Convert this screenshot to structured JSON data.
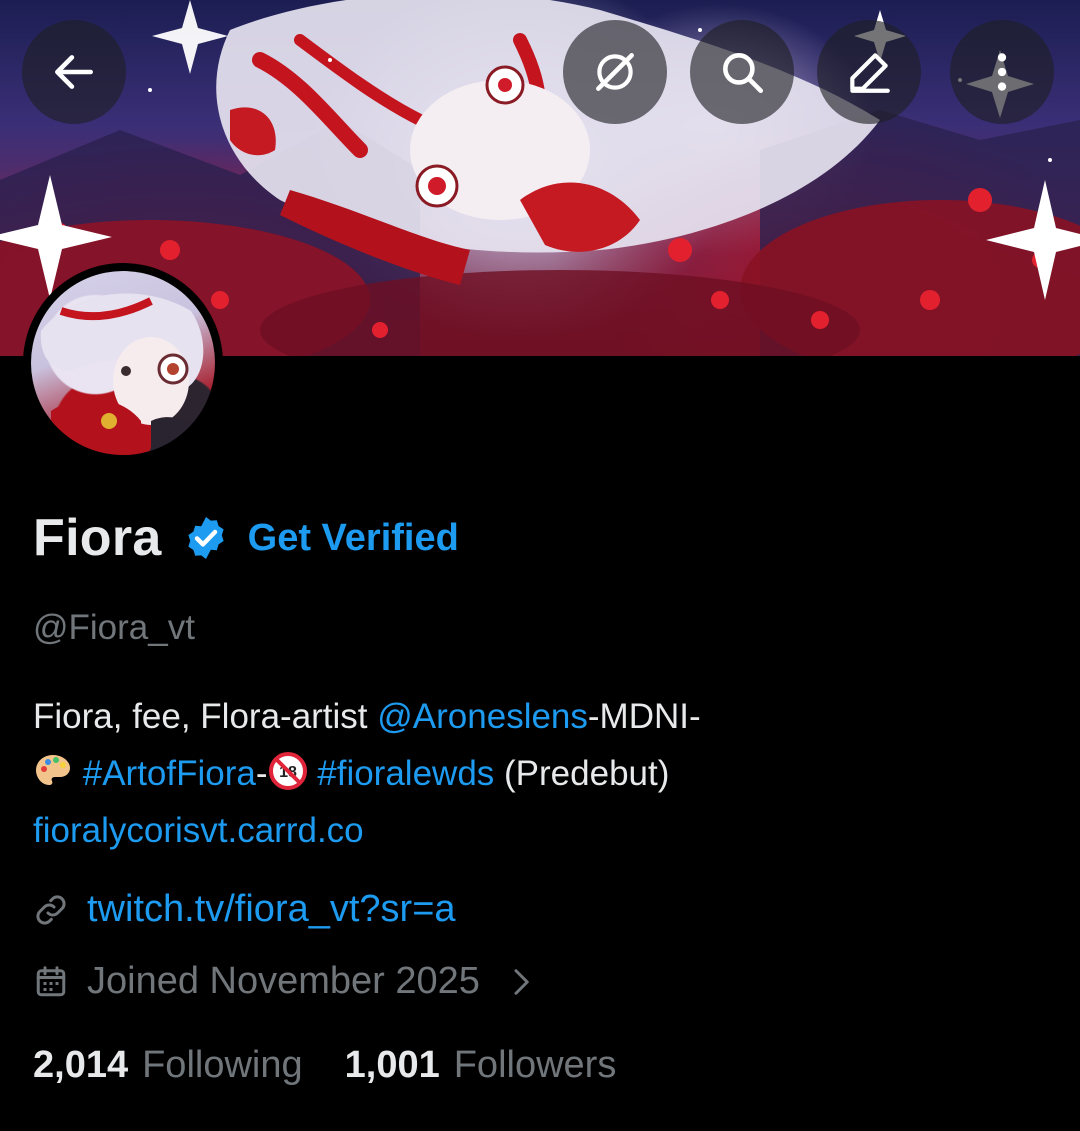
{
  "header": {
    "back_icon": "arrow-left-icon",
    "grok_icon": "grok-icon",
    "search_icon": "search-icon",
    "edit_icon": "pencil-icon",
    "more_icon": "vertical-dots-icon"
  },
  "profile": {
    "display_name": "Fiora",
    "verified_badge": "verified-badge-icon",
    "get_verified_label": "Get Verified",
    "handle": "@Fiora_vt",
    "bio": {
      "line1_text": "Fiora, fee, Flora-artist ",
      "line1_mention": "@Aroneslens",
      "line1_suffix": "-MDNI-",
      "line2_emoji1": "palette-emoji",
      "line2_hashtag1": "#ArtofFiora",
      "line2_dash": "-",
      "line2_emoji2": "no-one-under-18-emoji",
      "line2_hashtag2": "#fioralewds",
      "line2_suffix": " (Predebut)",
      "line3_link": "fioralycorisvt.carrd.co"
    },
    "website": "twitch.tv/fiora_vt?sr=a",
    "joined": "Joined November 2025",
    "following_count": "2,014",
    "following_label": "Following",
    "followers_count": "1,001",
    "followers_label": "Followers"
  },
  "colors": {
    "background": "#000000",
    "accent": "#1d9bf0",
    "primary_text": "#e7e9ea",
    "secondary_text": "#71767b"
  }
}
